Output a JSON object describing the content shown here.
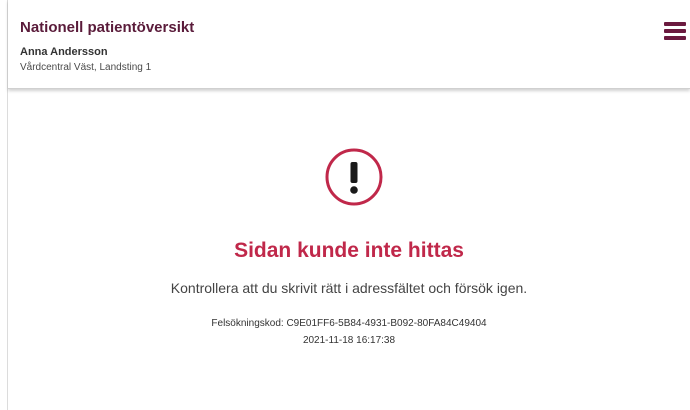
{
  "header": {
    "app_title": "Nationell patientöversikt",
    "user_name": "Anna Andersson",
    "user_unit": "Vårdcentral Väst, Landsting 1",
    "menu_icon": "hamburger-menu-icon"
  },
  "error": {
    "icon": "exclamation-circle-icon",
    "title": "Sidan kunde inte hittas",
    "description": "Kontrollera att du skrivit rätt i adressfältet och försök igen.",
    "debug_code_line": "Felsökningskod: C9E01FF6-5B84-4931-B092-80FA84C49404",
    "timestamp": "2021-11-18 16:17:38"
  },
  "colors": {
    "brand": "#5a1b3a",
    "error_accent": "#c0284a",
    "menu_icon": "#6b1a3f"
  }
}
